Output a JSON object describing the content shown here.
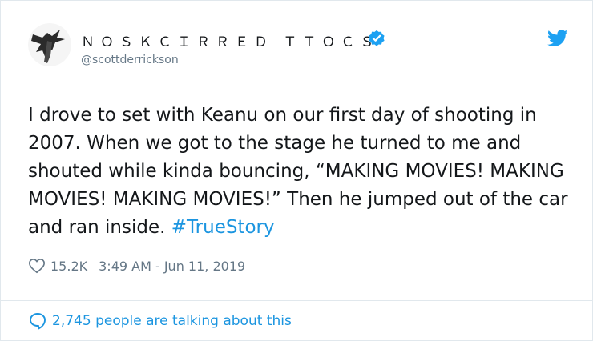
{
  "author": {
    "display_name": "ＮＯＳＫＣＩＲＲＥＤ ＴＴＯＣＳ",
    "handle": "@scottderrickson",
    "verified_icon": "verified-badge-icon",
    "platform_icon": "twitter-bird-icon"
  },
  "tweet": {
    "text": "I drove to set with Keanu on our first day of shooting in 2007. When we got to the stage he turned to me and shouted while kinda bouncing, “MAKING MOVIES! MAKING MOVIES! MAKING MOVIES!” Then he jumped out of the car and ran inside.",
    "hashtag": "#TrueStory"
  },
  "meta": {
    "like_icon": "heart-icon",
    "likes": "15.2K",
    "timestamp": "3:49 AM - Jun 11, 2019"
  },
  "footer": {
    "icon": "comment-bubble-icon",
    "conversation_text": "2,745 people are talking about this"
  },
  "colors": {
    "accent": "#1b95e0",
    "text": "#14171a",
    "muted": "#657786",
    "border": "#e1e8ed"
  }
}
